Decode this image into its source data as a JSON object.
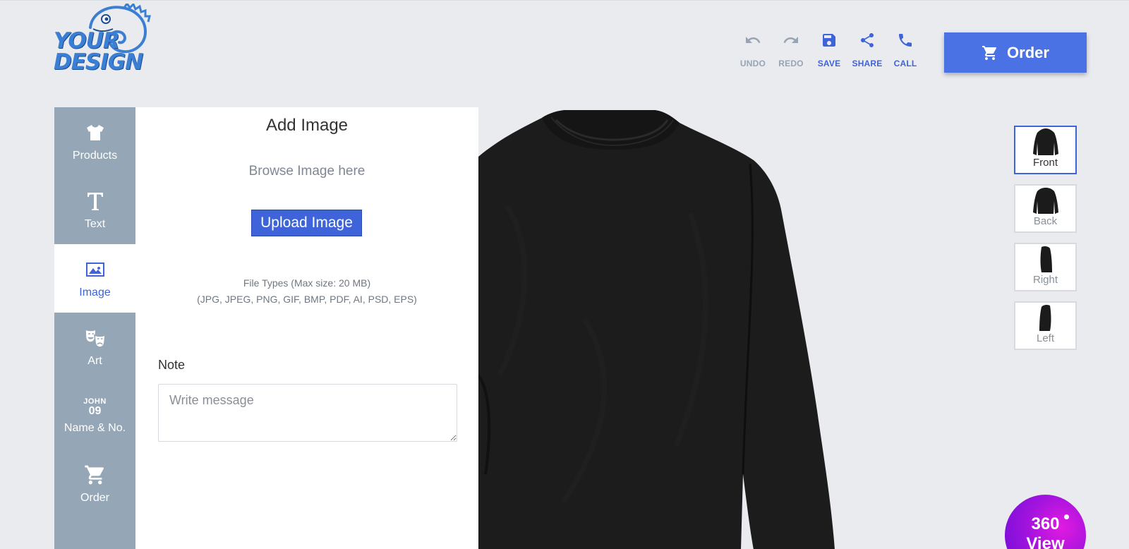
{
  "header": {
    "logo_line1": "YOUR",
    "logo_line2": "DESIGN",
    "tools": [
      {
        "label": "UNDO",
        "icon": "undo-icon"
      },
      {
        "label": "REDO",
        "icon": "redo-icon"
      },
      {
        "label": "SAVE",
        "icon": "save-icon"
      },
      {
        "label": "SHARE",
        "icon": "share-icon"
      },
      {
        "label": "CALL",
        "icon": "phone-icon"
      }
    ],
    "order_label": "Order"
  },
  "sidebar": {
    "items": [
      {
        "label": "Products",
        "icon": "tshirt-icon"
      },
      {
        "label": "Text",
        "icon": "text-icon"
      },
      {
        "label": "Image",
        "icon": "image-icon",
        "active": true
      },
      {
        "label": "Art",
        "icon": "theater-masks-icon"
      },
      {
        "label": "Name & No.",
        "icon": "jersey-number-icon",
        "glyph_top": "JOHN",
        "glyph_bottom": "09"
      },
      {
        "label": "Order",
        "icon": "cart-icon"
      }
    ]
  },
  "panel": {
    "title": "Add Image",
    "browse_text": "Browse Image here",
    "upload_label": "Upload Image",
    "file_types_line1": "File Types (Max size: 20 MB)",
    "file_types_line2": "(JPG, JPEG, PNG, GIF, BMP, PDF, AI, PSD, EPS)",
    "note_label": "Note",
    "note_placeholder": "Write message",
    "note_value": ""
  },
  "views": [
    {
      "label": "Front",
      "active": true
    },
    {
      "label": "Back",
      "active": false
    },
    {
      "label": "Right",
      "active": false
    },
    {
      "label": "Left",
      "active": false
    }
  ],
  "view360": {
    "line1": "360",
    "line2": "View"
  },
  "colors": {
    "accent": "#3f63d9",
    "order_button": "#4a72e4",
    "sidebar": "#95a7b6",
    "background": "#e9ebef",
    "garment": "#1b1b1b",
    "badge": "#a214de"
  }
}
